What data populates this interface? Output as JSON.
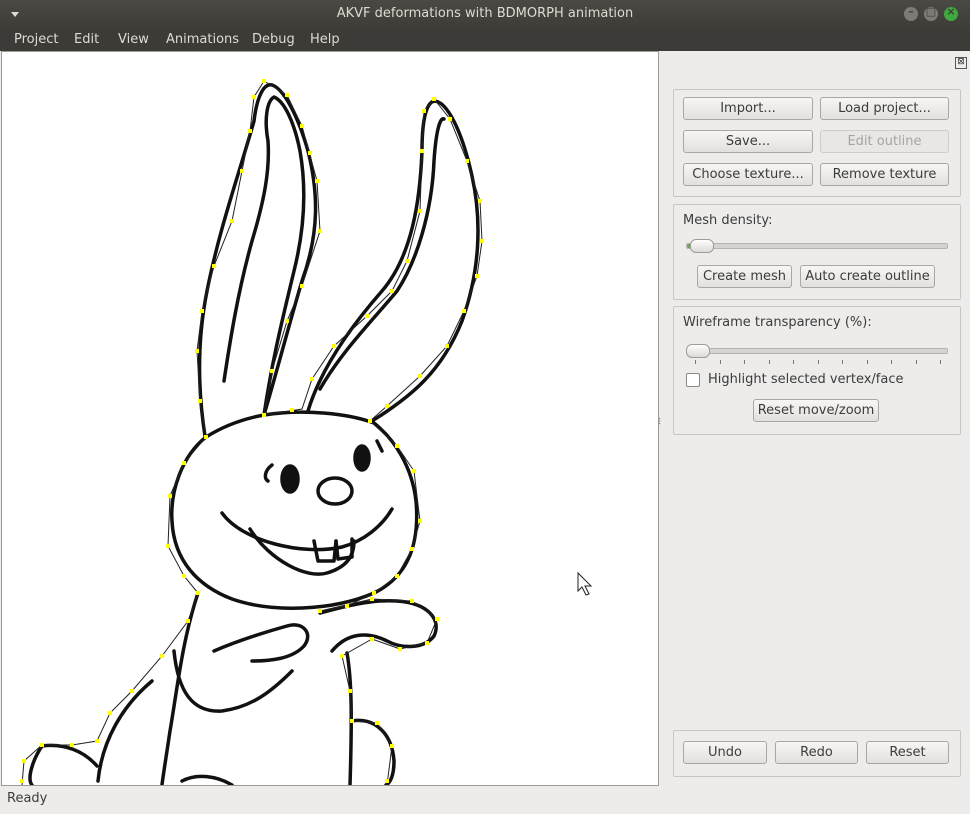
{
  "window": {
    "title": "AKVF deformations with BDMORPH animation"
  },
  "menubar": {
    "items": [
      "Project",
      "Edit",
      "View",
      "Animations",
      "Debug",
      "Help"
    ]
  },
  "panel": {
    "close_glyph": "⊠",
    "file_buttons": {
      "import": "Import...",
      "load_project": "Load project...",
      "save": "Save...",
      "edit_outline": "Edit outline",
      "choose_texture": "Choose texture...",
      "remove_texture": "Remove texture"
    },
    "mesh": {
      "label": "Mesh density:",
      "create_mesh": "Create mesh",
      "auto_outline": "Auto create outline"
    },
    "wireframe": {
      "label": "Wireframe transparency (%):",
      "highlight_label": "Highlight selected vertex/face",
      "highlight_checked": false,
      "reset_move": "Reset move/zoom"
    },
    "history": {
      "undo": "Undo",
      "redo": "Redo",
      "reset": "Reset"
    }
  },
  "status": {
    "text": "Ready"
  },
  "colors": {
    "outline_vertex": "#ffff00",
    "titlebar": "#3c3b37",
    "close_button": "#3fa83f"
  }
}
